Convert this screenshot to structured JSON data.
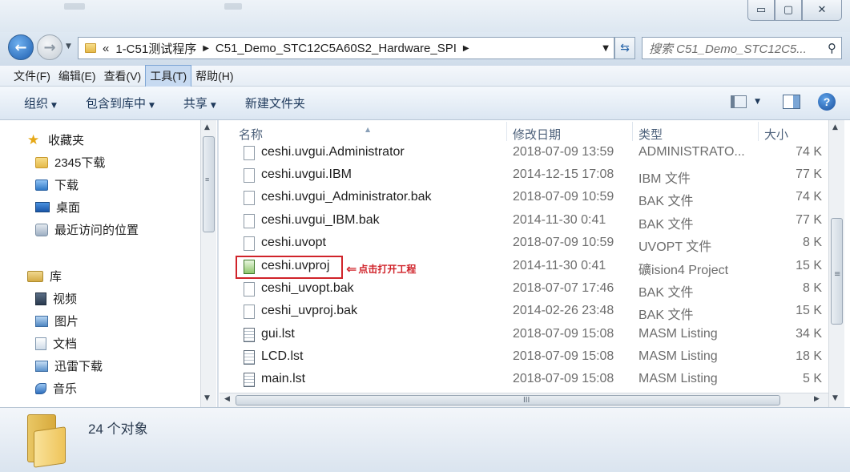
{
  "window": {
    "min_symbol": "▭",
    "max_symbol": "▢",
    "close_symbol": "✕"
  },
  "address": {
    "recent_symbol": "«",
    "crumbs": [
      "1-C51测试程序",
      "C51_Demo_STC12C5A60S2_Hardware_SPI"
    ],
    "separator_symbol": "▶",
    "dropdown_symbol": "▼",
    "refresh_symbol": "⇆",
    "search_placeholder": "搜索 C51_Demo_STC12C5..."
  },
  "menu": [
    "文件(F)",
    "编辑(E)",
    "查看(V)",
    "工具(T)",
    "帮助(H)"
  ],
  "menu_active_index": 3,
  "toolbar": {
    "organize": "组织",
    "include_in_library": "包含到库中",
    "share": "共享",
    "new_folder": "新建文件夹",
    "caret": "▼",
    "help": "?"
  },
  "nav": {
    "favorites": "收藏夹",
    "downloads_2345": "2345下载",
    "downloads": "下载",
    "desktop": "桌面",
    "recent_places": "最近访问的位置",
    "libraries": "库",
    "videos": "视频",
    "pictures": "图片",
    "documents": "文档",
    "xunlei": "迅雷下载",
    "music": "音乐"
  },
  "columns": {
    "name": "名称",
    "date": "修改日期",
    "type": "类型",
    "size": "大小"
  },
  "files": [
    {
      "name": "ceshi.uvgui.Administrator",
      "date": "2018-07-09 13:59",
      "type": "ADMINISTRATO...",
      "size": "74 K",
      "icon": "blank-file-icon"
    },
    {
      "name": "ceshi.uvgui.IBM",
      "date": "2014-12-15 17:08",
      "type": "IBM 文件",
      "size": "77 K",
      "icon": "blank-file-icon"
    },
    {
      "name": "ceshi.uvgui_Administrator.bak",
      "date": "2018-07-09 10:59",
      "type": "BAK 文件",
      "size": "74 K",
      "icon": "blank-file-icon"
    },
    {
      "name": "ceshi.uvgui_IBM.bak",
      "date": "2014-11-30 0:41",
      "type": "BAK 文件",
      "size": "77 K",
      "icon": "blank-file-icon"
    },
    {
      "name": "ceshi.uvopt",
      "date": "2018-07-09 10:59",
      "type": "UVOPT 文件",
      "size": "8 K",
      "icon": "blank-file-icon"
    },
    {
      "name": "ceshi.uvproj",
      "date": "2014-11-30 0:41",
      "type": "礦ision4 Project",
      "size": "15 K",
      "icon": "uvision-project-icon"
    },
    {
      "name": "ceshi_uvopt.bak",
      "date": "2018-07-07 17:46",
      "type": "BAK 文件",
      "size": "8 K",
      "icon": "blank-file-icon"
    },
    {
      "name": "ceshi_uvproj.bak",
      "date": "2014-02-26 23:48",
      "type": "BAK 文件",
      "size": "15 K",
      "icon": "blank-file-icon"
    },
    {
      "name": "gui.lst",
      "date": "2018-07-09 15:08",
      "type": "MASM Listing",
      "size": "34 K",
      "icon": "listing-file-icon"
    },
    {
      "name": "LCD.lst",
      "date": "2018-07-09 15:08",
      "type": "MASM Listing",
      "size": "18 K",
      "icon": "listing-file-icon"
    },
    {
      "name": "main.lst",
      "date": "2018-07-09 15:08",
      "type": "MASM Listing",
      "size": "5 K",
      "icon": "listing-file-icon"
    }
  ],
  "annotation": {
    "text": "点击打开工程",
    "arrow_symbol": "⇐"
  },
  "scroll": {
    "up": "▲",
    "down": "▼",
    "left": "◀",
    "right": "▶",
    "grip_v": "≡",
    "grip_h": "III"
  },
  "status": {
    "count": "24 个对象"
  },
  "colors": {
    "highlight": "#d0232a",
    "menu_active_bg": "#c7daf1",
    "toolbar_text": "#1e395b"
  }
}
